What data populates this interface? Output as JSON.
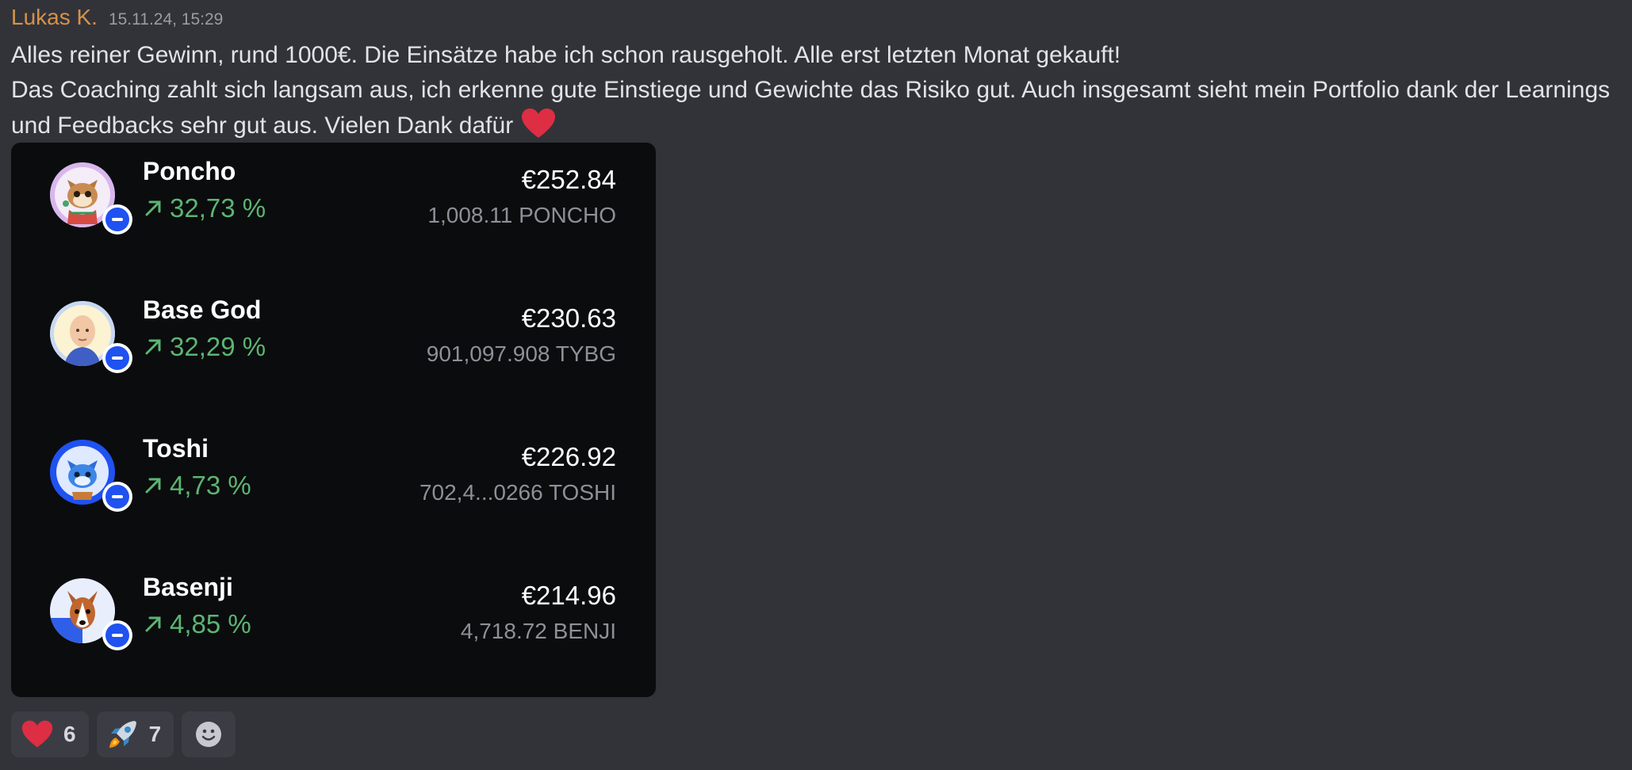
{
  "message": {
    "author": "Lukas K.",
    "timestamp": "15.11.24, 15:29",
    "lines": [
      "Alles reiner Gewinn, rund 1000€. Die Einsätze habe ich schon rausgeholt. Alle erst letzten Monat gekauft!",
      "Das Coaching zahlt sich langsam aus, ich erkenne gute Einstiege und Gewichte das Risiko gut. Auch insgesamt sieht mein Portfolio dank der Learnings",
      "und Feedbacks sehr gut aus. Vielen Dank dafür"
    ],
    "inline_emoji": "heart-emoji"
  },
  "portfolio": {
    "tokens": [
      {
        "name": "Poncho",
        "change": "32,73 %",
        "value": "€252.84",
        "amount": "1,008.11 PONCHO",
        "avatar": "cat-avatar"
      },
      {
        "name": "Base God",
        "change": "32,29 %",
        "value": "€230.63",
        "amount": "901,097.908 TYBG",
        "avatar": "bald-man-avatar"
      },
      {
        "name": "Toshi",
        "change": "4,73 %",
        "value": "€226.92",
        "amount": "702,4...0266 TOSHI",
        "avatar": "blue-cat-avatar"
      },
      {
        "name": "Basenji",
        "change": "4,85 %",
        "value": "€214.96",
        "amount": "4,718.72 BENJI",
        "avatar": "dog-avatar"
      }
    ],
    "change_icon": "arrow-up-right-icon",
    "badge_icon": "base-chain-icon",
    "colors": {
      "positive": "#5bb572",
      "card_bg": "#0b0c0e",
      "chain_blue": "#1f52f0"
    }
  },
  "reactions": [
    {
      "emoji": "heart-emoji",
      "count": "6"
    },
    {
      "emoji": "rocket-emoji",
      "count": "7"
    }
  ],
  "add_reaction_icon": "smiley-add-icon"
}
